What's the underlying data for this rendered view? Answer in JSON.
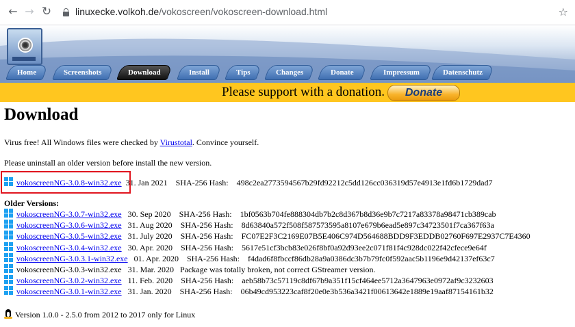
{
  "browser": {
    "url_host": "linuxecke.volkoh.de",
    "url_path": "/vokoscreen/vokoscreen-download.html"
  },
  "nav": {
    "tabs": [
      "Home",
      "Screenshots",
      "Download",
      "Install",
      "Tips",
      "Changes",
      "Donate",
      "Impressum",
      "Datenschutz"
    ],
    "active": "Download"
  },
  "donate": {
    "text": "Please support with a donation.",
    "button": "Donate"
  },
  "page": {
    "title": "Download",
    "virus_pre": "Virus free! All Windows files were checked by ",
    "virus_link": "Virustotal",
    "virus_post": ". Convince yourself.",
    "uninstall": "Please uninstall an older version before install the new version."
  },
  "current": {
    "file": "vokoscreenNG-3.0.8-win32.exe",
    "date": "31. Jan 2021",
    "hash_label": "SHA-256 Hash:",
    "hash": "498c2ea2773594567b29fd92212c5dd126cc036319d57e4913e1fd6b1729dad7"
  },
  "older": {
    "title": "Older Versions:",
    "rows": [
      {
        "file": "vokoscreenNG-3.0.7-win32.exe",
        "date": "30. Sep 2020",
        "hash_label": "SHA-256 Hash:",
        "hash": "1bf0563b704fe888304db7b2c8d367b8d36e9b7c7217a83378a98471cb389cab",
        "link": true
      },
      {
        "file": "vokoscreenNG-3.0.6-win32.exe",
        "date": "31. Aug 2020",
        "hash_label": "SHA-256 Hash:",
        "hash": "8d63840a572f508f587573595a8107e679b6ead5e897c34723501f7ca367f63a",
        "link": true
      },
      {
        "file": "vokoscreenNG-3.0.5-win32.exe",
        "date": "31. July 2020",
        "hash_label": "SHA-256 Hash:",
        "hash": "FC07E2F3C2169E07B5E406C974D564688BDD9F3EDDB02760F697E2937C7E4360",
        "link": true
      },
      {
        "file": "vokoscreenNG-3.0.4-win32.exe",
        "date": "30. Apr. 2020",
        "hash_label": "SHA-256 Hash:",
        "hash": "5617e51cf3bcb83e026f8bf0a92d93ee2c071f81f4c928dc022f42cfece9e64f",
        "link": true
      },
      {
        "file": "vokoscreenNG-3.0.3.1-win32.exe",
        "date": "01. Apr. 2020",
        "hash_label": "SHA-256 Hash:",
        "hash": "f4dad6f8fbccf86db28a9a0386dc3b7b79fc0f592aac5b1196e9d42137ef63c7",
        "link": true
      },
      {
        "file": "vokoscreenNG-3.0.3-win32.exe",
        "date": "31. Mar. 2020",
        "hash_label": "",
        "hash": "Package was totally broken, not correct GStreamer version.",
        "link": false
      },
      {
        "file": "vokoscreenNG-3.0.2-win32.exe",
        "date": "11. Feb. 2020",
        "hash_label": "SHA-256 Hash:",
        "hash": "aeb58b73c57119c8df67b9a351f15cf464ee5712a3647963e0972af9c3232603",
        "link": true
      },
      {
        "file": "vokoscreenNG-3.0.1-win32.exe",
        "date": "31. Jan. 2020",
        "hash_label": "SHA-256 Hash:",
        "hash": "06b49cd953223caf8f20e0e3b536a3421f00613642e1889e19aaf87154161b32",
        "link": true
      }
    ]
  },
  "linux_note": "Version 1.0.0 - 2.5.0 from 2012 to 2017 only for Linux",
  "colors": {
    "donate_bar": "#ffc61f",
    "link": "#0000ee",
    "highlight": "#e0141e",
    "windows_icon": "#1ea1f1"
  }
}
